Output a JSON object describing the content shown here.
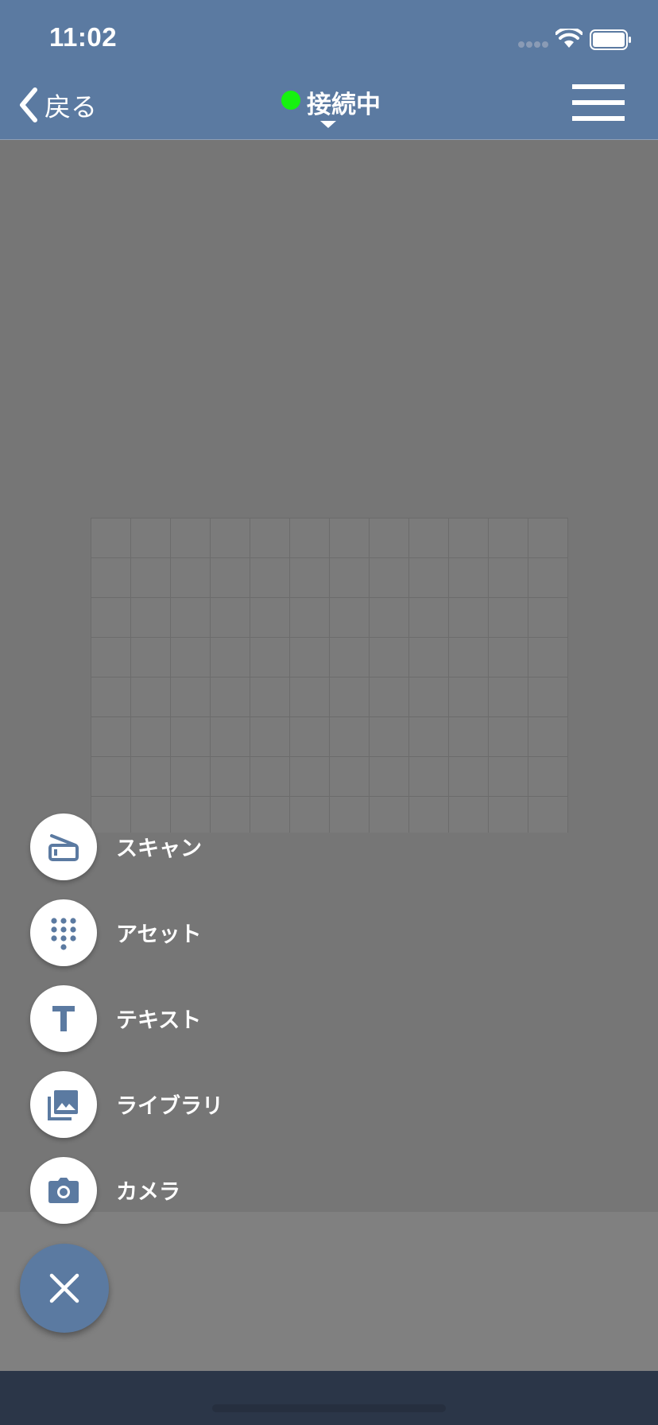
{
  "status_bar": {
    "time": "11:02",
    "wifi_icon": "wifi-icon",
    "battery_icon": "battery-icon"
  },
  "nav": {
    "back_label": "戻る",
    "back_icon": "chevron-left-icon",
    "connection_label": "接続中",
    "connection_color": "#16f20f",
    "menu_icon": "hamburger-icon"
  },
  "speed_dial": {
    "items": [
      {
        "label": "スキャン",
        "icon": "scanner-icon"
      },
      {
        "label": "アセット",
        "icon": "dots-grid-icon"
      },
      {
        "label": "テキスト",
        "icon": "text-icon"
      },
      {
        "label": "ライブラリ",
        "icon": "photo-library-icon"
      },
      {
        "label": "カメラ",
        "icon": "camera-icon"
      }
    ],
    "close_icon": "close-icon"
  },
  "colors": {
    "header": "#5b7aa1",
    "accent": "#5b7aa1",
    "background": "#767676",
    "home_bar": "#2b3648"
  }
}
